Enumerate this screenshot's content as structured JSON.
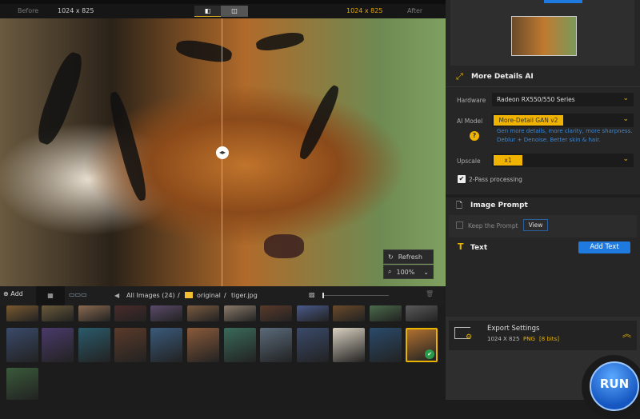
{
  "compare": {
    "before_label": "Before",
    "before_size": "1024 x 825",
    "after_size": "1024 x 825",
    "after_label": "After"
  },
  "viewer": {
    "refresh_label": "Refresh",
    "zoom": "100%"
  },
  "toolbar": {
    "add_label": "Add",
    "breadcrumb_all": "All Images (24)",
    "sep": "/",
    "folder": "original",
    "file": "tiger.jpg"
  },
  "thumbnails": {
    "row1": [
      "#7a5a30",
      "#6a5a3a",
      "#8a6a50",
      "#4a2a2a",
      "#5a4a6a",
      "#7a5a40",
      "#8a7a6a",
      "#5a3a2a",
      "#4a5a8a",
      "#6a4a2a",
      "#4a6a4a",
      "#5a5a5a"
    ],
    "row2": [
      "#3a4a6a",
      "#4a3a6a",
      "#2a5a6a",
      "#5a3a2a",
      "#3a5a7a",
      "#8a5a3a",
      "#3a6a5a",
      "#5a6a7a",
      "#3a4a6a",
      "#d8d0c0",
      "#2a4a6a",
      "#b07030"
    ],
    "row3": [
      "#3a5a3a"
    ],
    "selected_index": 11
  },
  "panel": {
    "section_title": "More Details AI",
    "hardware_label": "Hardware",
    "hardware_value": "Radeon RX550/550 Series",
    "model_label": "AI Model",
    "model_value": "More-Detail GAN v2",
    "model_desc1": "Gen more details, more clarity, more sharpness.",
    "model_desc2": "Deblur + Denoise. Better skin & hair.",
    "upscale_label": "Upscale",
    "upscale_value": "x1",
    "two_pass_label": "2-Pass processing",
    "two_pass_checked": true,
    "prompt_title": "Image Prompt",
    "keep_prompt_label": "Keep the Prompt",
    "keep_prompt_checked": false,
    "view_label": "View",
    "text_title": "Text",
    "add_text_label": "Add Text",
    "export_title": "Export Settings",
    "export_size": "1024 X 825",
    "export_format": "PNG",
    "export_bits": "[8 bits]",
    "run_label": "RUN"
  },
  "colors": {
    "accent": "#f0b400",
    "blue": "#1f7ae0"
  }
}
